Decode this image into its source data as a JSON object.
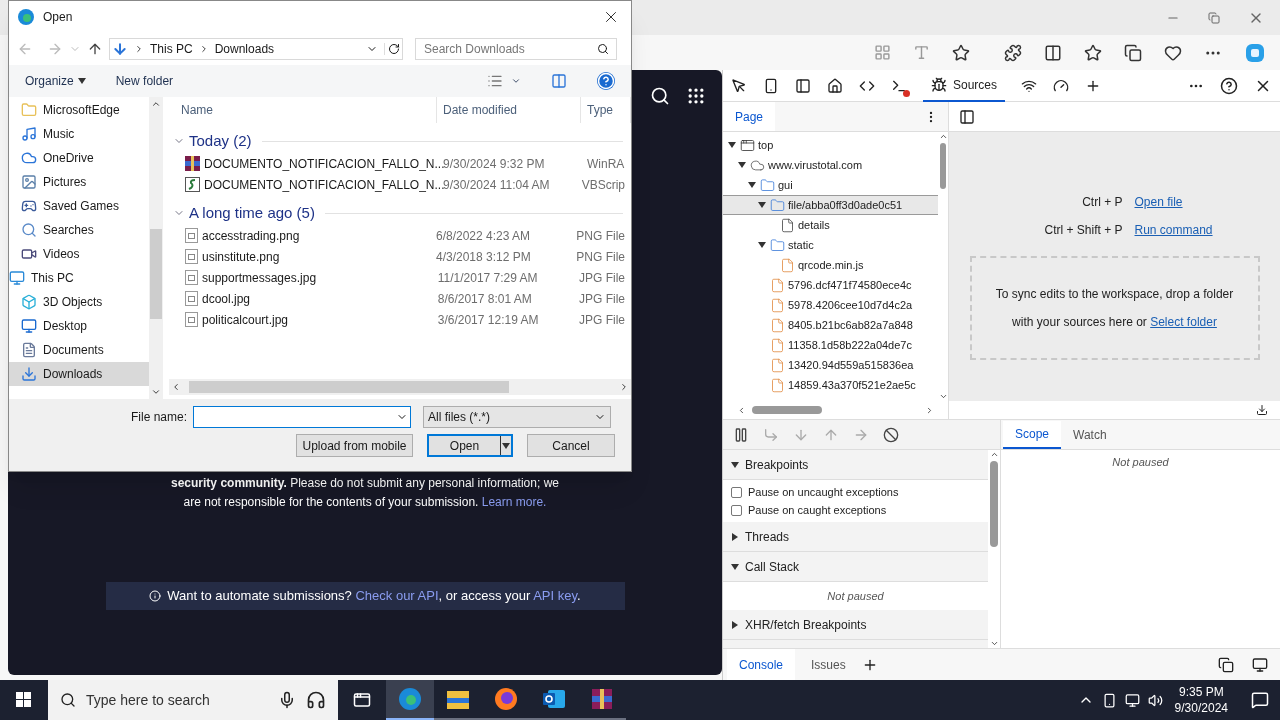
{
  "dialog": {
    "title": "Open",
    "breadcrumb": [
      "This PC",
      "Downloads"
    ],
    "search": {
      "placeholder": "Search Downloads"
    },
    "commands": [
      "Organize",
      "New folder"
    ],
    "nav_tree": [
      {
        "children": [
          {
            "label": "MicrosoftEdge",
            "kind": "folder",
            "selected": false
          },
          {
            "label": "Music",
            "kind": "music",
            "selected": false
          },
          {
            "label": "OneDrive",
            "kind": "cloud",
            "selected": false
          },
          {
            "label": "Pictures",
            "kind": "pictures",
            "selected": false
          },
          {
            "label": "Saved Games",
            "kind": "games",
            "selected": false
          },
          {
            "label": "Searches",
            "kind": "search",
            "selected": false
          },
          {
            "label": "Videos",
            "kind": "videos",
            "selected": false
          }
        ]
      },
      {
        "label": "This PC",
        "kind": "pc",
        "selected": false,
        "children": [
          {
            "label": "3D Objects",
            "kind": "objects",
            "selected": false
          },
          {
            "label": "Desktop",
            "kind": "desktop",
            "selected": false
          },
          {
            "label": "Documents",
            "kind": "documents",
            "selected": false
          },
          {
            "label": "Downloads",
            "kind": "downloads",
            "selected": true
          }
        ]
      }
    ],
    "columns": [
      "Name",
      "Date modified",
      "Type"
    ],
    "groups": [
      {
        "title": "Today (2)",
        "expanded": true,
        "files": [
          {
            "name": "DOCUMENTO_NOTIFICACION_FALLO_N...",
            "date": "9/30/2024 9:32 PM",
            "type": "WinRA",
            "kind": "rar"
          },
          {
            "name": "DOCUMENTO_NOTIFICACION_FALLO_N...",
            "date": "9/30/2024 11:04 AM",
            "type": "VBScrip",
            "kind": "vbs"
          }
        ]
      },
      {
        "title": "A long time ago (5)",
        "expanded": true,
        "files": [
          {
            "name": "accesstrading.png",
            "date": "6/8/2022 4:23 AM",
            "type": "PNG File",
            "kind": "image"
          },
          {
            "name": "usinstitute.png",
            "date": "4/3/2018 3:12 PM",
            "type": "PNG File",
            "kind": "image"
          },
          {
            "name": "supportmessages.jpg",
            "date": "11/1/2017 7:29 AM",
            "type": "JPG File",
            "kind": "image"
          },
          {
            "name": "dcool.jpg",
            "date": "8/6/2017 8:01 AM",
            "type": "JPG File",
            "kind": "image"
          },
          {
            "name": "politicalcourt.jpg",
            "date": "3/6/2017 12:19 AM",
            "type": "JPG File",
            "kind": "image"
          }
        ]
      }
    ],
    "file_name": {
      "label": "File name:"
    },
    "filter": "All files (*.*)",
    "buttons": [
      {
        "label": "Upload from mobile",
        "kind": "plain"
      },
      {
        "label": "Open",
        "kind": "split"
      },
      {
        "label": "Cancel",
        "kind": "plain"
      }
    ]
  },
  "page": {
    "notice": "**security community.** Please do not submit any personal information; we are not responsible for the contents of your submission.",
    "notice_link": "Learn more.",
    "banner": [
      {
        "text": "Want to automate submissions? ",
        "kind": "text"
      },
      {
        "text": "Check our API",
        "kind": "link"
      },
      {
        "text": ", or access your ",
        "kind": "text"
      },
      {
        "text": "API key",
        "kind": "link"
      },
      {
        "text": ".",
        "kind": "text"
      }
    ]
  },
  "devtools": {
    "tabs": [
      {
        "label": "Sources",
        "selected": true
      }
    ],
    "navigator_tabs": [
      {
        "label": "Page",
        "selected": true
      }
    ],
    "tree": [
      {
        "label": "top",
        "kind": "frame",
        "expanded": true,
        "selected": false,
        "children": [
          {
            "label": "www.virustotal.com",
            "kind": "domain",
            "expanded": true,
            "selected": false,
            "children": [
              {
                "label": "gui",
                "kind": "folder",
                "expanded": true,
                "selected": false,
                "children": [
                  {
                    "label": "file/abba0ff3d0ade0c51",
                    "kind": "folder",
                    "expanded": true,
                    "selected": true,
                    "children": [
                      {
                        "label": "details",
                        "kind": "doc",
                        "selected": false
                      }
                    ]
                  },
                  {
                    "label": "static",
                    "kind": "folder",
                    "expanded": true,
                    "selected": false,
                    "children": [
                      {
                        "label": "qrcode.min.js",
                        "kind": "script",
                        "selected": false
                      }
                    ]
                  },
                  {
                    "label": "5796.dcf471f74580ece4c",
                    "kind": "script",
                    "selected": false
                  },
                  {
                    "label": "5978.4206cee10d7d4c2a",
                    "kind": "script",
                    "selected": false
                  },
                  {
                    "label": "8405.b21bc6ab82a7a848",
                    "kind": "script",
                    "selected": false
                  },
                  {
                    "label": "11358.1d58b222a04de7c",
                    "kind": "script",
                    "selected": false
                  },
                  {
                    "label": "13420.94d559a515836ea",
                    "kind": "script",
                    "selected": false
                  },
                  {
                    "label": "14859.43a370f521e2ae5c",
                    "kind": "script",
                    "selected": false
                  }
                ]
              }
            ]
          }
        ]
      }
    ],
    "shortcuts": [
      {
        "keys": "Ctrl + P",
        "action": "Open file"
      },
      {
        "keys": "Ctrl + Shift + P",
        "action": "Run command"
      }
    ],
    "dropzone": {
      "text": "To sync edits to the workspace, drop a folder with your sources here or",
      "link": "Select folder"
    },
    "sections": [
      {
        "title": "Breakpoints",
        "expanded": true,
        "kind": "checks",
        "items": [
          {
            "label": "Pause on uncaught exceptions",
            "checked": false
          },
          {
            "label": "Pause on caught exceptions",
            "checked": false
          }
        ]
      },
      {
        "title": "Threads",
        "expanded": false,
        "kind": "empty"
      },
      {
        "title": "Call Stack",
        "expanded": true,
        "kind": "message",
        "message": "Not paused"
      },
      {
        "title": "XHR/fetch Breakpoints",
        "expanded": false,
        "kind": "empty"
      }
    ],
    "scope_tabs": [
      {
        "label": "Scope",
        "selected": true
      },
      {
        "label": "Watch",
        "selected": false
      }
    ],
    "scope_message": "Not paused",
    "drawer_tabs": [
      {
        "label": "Console",
        "selected": true
      },
      {
        "label": "Issues",
        "selected": false
      }
    ]
  },
  "taskbar": {
    "search": {
      "placeholder": "Type here to search"
    },
    "apps": [
      {
        "kind": "edge",
        "active": true
      },
      {
        "kind": "explorer",
        "active": false
      },
      {
        "kind": "firefox",
        "active": false
      },
      {
        "kind": "outlook",
        "active": false
      },
      {
        "kind": "winrar",
        "active": false
      }
    ],
    "time": "9:35 PM",
    "date": "9/30/2024"
  }
}
